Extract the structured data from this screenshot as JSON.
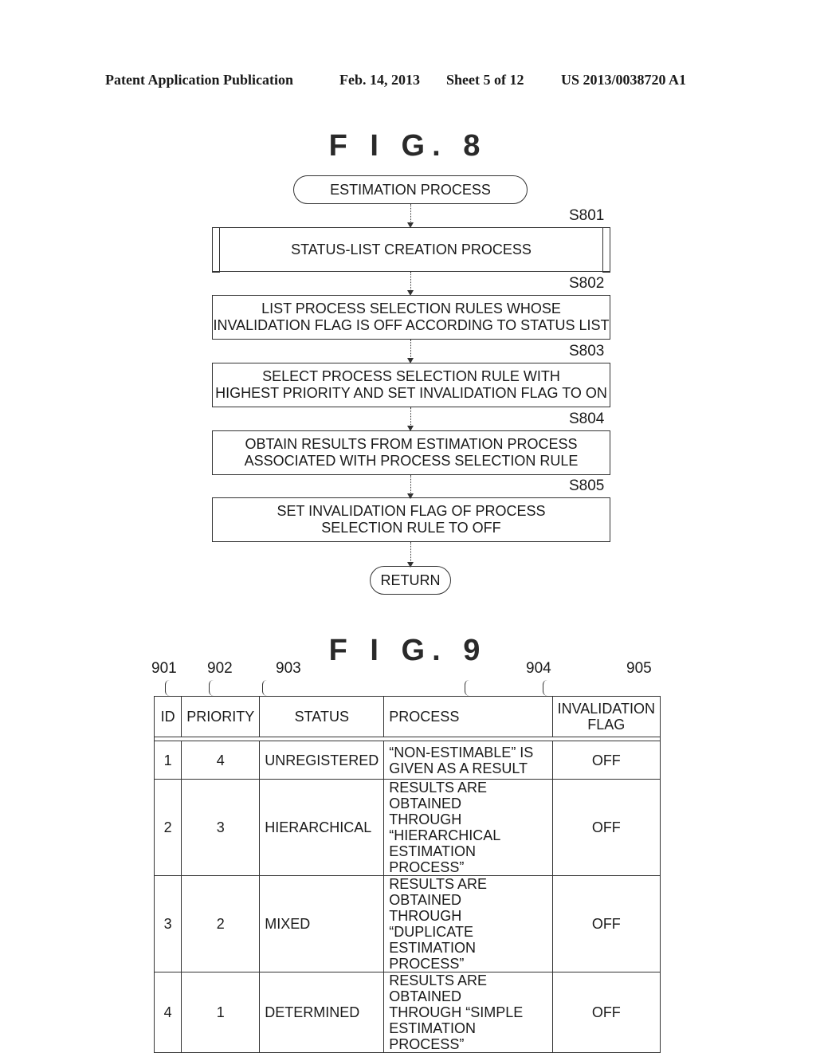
{
  "header": {
    "publication": "Patent Application Publication",
    "date": "Feb. 14, 2013",
    "sheet": "Sheet 5 of 12",
    "number": "US 2013/0038720 A1"
  },
  "fig8": {
    "title": "F I G. 8",
    "start": "ESTIMATION PROCESS",
    "end": "RETURN",
    "steps": [
      {
        "id": "S801",
        "lines": [
          "STATUS-LIST CREATION PROCESS"
        ],
        "type": "predefined-process"
      },
      {
        "id": "S802",
        "lines": [
          "LIST PROCESS SELECTION RULES WHOSE",
          "INVALIDATION FLAG IS OFF ACCORDING TO STATUS LIST"
        ],
        "type": "process"
      },
      {
        "id": "S803",
        "lines": [
          "SELECT PROCESS SELECTION RULE WITH",
          "HIGHEST PRIORITY AND SET INVALIDATION FLAG TO ON"
        ],
        "type": "process"
      },
      {
        "id": "S804",
        "lines": [
          "OBTAIN RESULTS FROM ESTIMATION PROCESS",
          "ASSOCIATED WITH PROCESS SELECTION RULE"
        ],
        "type": "process"
      },
      {
        "id": "S805",
        "lines": [
          "SET INVALIDATION FLAG OF PROCESS",
          "SELECTION RULE TO OFF"
        ],
        "type": "process"
      }
    ]
  },
  "fig9": {
    "title": "F I G. 9",
    "refs": [
      "901",
      "902",
      "903",
      "904",
      "905"
    ],
    "columns": [
      "ID",
      "PRIORITY",
      "STATUS",
      "PROCESS",
      "INVALIDATION FLAG"
    ],
    "column_lines": [
      [
        "ID"
      ],
      [
        "PRIORITY"
      ],
      [
        "STATUS"
      ],
      [
        "PROCESS"
      ],
      [
        "INVALIDATION",
        "FLAG"
      ]
    ],
    "rows": [
      {
        "id": "1",
        "priority": "4",
        "status": "UNREGISTERED",
        "process": [
          "“NON-ESTIMABLE” IS",
          "GIVEN AS A RESULT"
        ],
        "flag": "OFF"
      },
      {
        "id": "2",
        "priority": "3",
        "status": "HIERARCHICAL",
        "process": [
          "RESULTS ARE OBTAINED",
          "THROUGH “HIERARCHICAL",
          "ESTIMATION PROCESS”"
        ],
        "flag": "OFF"
      },
      {
        "id": "3",
        "priority": "2",
        "status": "MIXED",
        "process": [
          "RESULTS ARE OBTAINED",
          "THROUGH “DUPLICATE",
          "ESTIMATION PROCESS”"
        ],
        "flag": "OFF"
      },
      {
        "id": "4",
        "priority": "1",
        "status": "DETERMINED",
        "process": [
          "RESULTS ARE OBTAINED",
          "THROUGH “SIMPLE",
          "ESTIMATION PROCESS”"
        ],
        "flag": "OFF"
      }
    ]
  }
}
